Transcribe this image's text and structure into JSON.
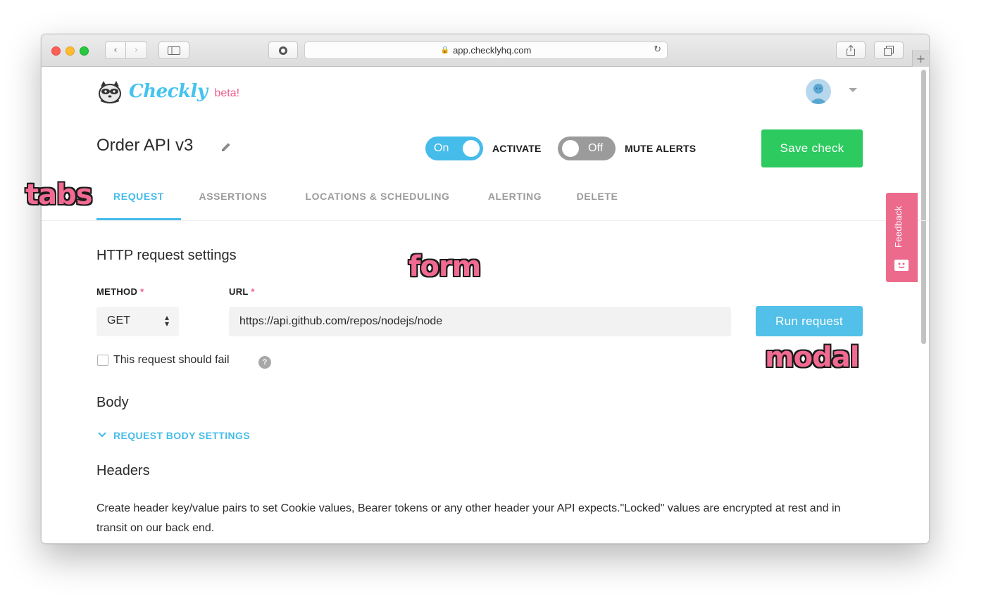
{
  "browser": {
    "url": "app.checklyhq.com"
  },
  "brand": {
    "name": "Checkly",
    "badge": "beta!",
    "accent": "#45bcea",
    "pink": "#ec5d8d"
  },
  "check": {
    "title": "Order API v3",
    "activate_toggle": {
      "label": "On",
      "state": "on"
    },
    "activate_caption": "ACTIVATE",
    "mute_toggle": {
      "label": "Off",
      "state": "off"
    },
    "mute_caption": "MUTE ALERTS",
    "save_label": "Save check"
  },
  "tabs": [
    {
      "label": "REQUEST",
      "active": true
    },
    {
      "label": "ASSERTIONS",
      "active": false
    },
    {
      "label": "LOCATIONS & SCHEDULING",
      "active": false
    },
    {
      "label": "ALERTING",
      "active": false
    },
    {
      "label": "DELETE",
      "active": false
    }
  ],
  "request": {
    "heading": "HTTP request settings",
    "method_label": "METHOD",
    "method_value": "GET",
    "url_label": "URL",
    "required_mark": "*",
    "url_value": "https://api.github.com/repos/nodejs/node",
    "run_label": "Run request",
    "fail_label": "This request should fail",
    "fail_checked": false,
    "help_glyph": "?"
  },
  "body": {
    "heading": "Body",
    "settings_link": "REQUEST BODY SETTINGS"
  },
  "headers": {
    "heading": "Headers",
    "description": "Create header key/value pairs to set Cookie values, Bearer tokens or any other header your API expects.\"Locked\" values are encrypted at rest and in transit on our back end."
  },
  "feedback": {
    "label": "Feedback"
  },
  "annotations": {
    "tabs": "tabs",
    "form": "form",
    "modal": "modal"
  }
}
